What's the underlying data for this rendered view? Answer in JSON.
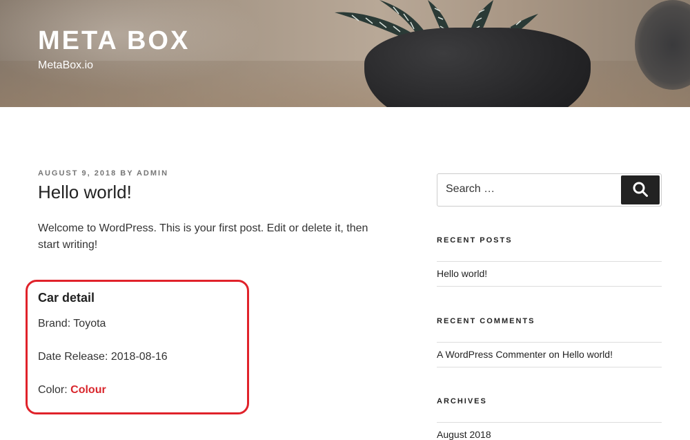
{
  "site": {
    "title": "META BOX",
    "description": "MetaBox.io"
  },
  "post": {
    "meta": "AUGUST 9, 2018 BY ADMIN",
    "title": "Hello world!",
    "body": "Welcome to WordPress. This is your first post. Edit or delete it, then start writing!"
  },
  "car_detail": {
    "heading": "Car detail",
    "brand_label": "Brand:",
    "brand_value": "Toyota",
    "date_label": "Date Release:",
    "date_value": "2018-08-16",
    "color_label": "Color:",
    "color_value": "Colour",
    "highlight_color": "#e0222a"
  },
  "sidebar": {
    "search": {
      "placeholder": "Search …",
      "button_icon": "search-icon"
    },
    "recent_posts": {
      "title": "RECENT POSTS",
      "items": [
        "Hello world!"
      ]
    },
    "recent_comments": {
      "title": "RECENT COMMENTS",
      "items": [
        {
          "author": "A WordPress Commenter",
          "connector": "on",
          "post": "Hello world!"
        }
      ]
    },
    "archives": {
      "title": "ARCHIVES",
      "items": [
        "August 2018"
      ]
    }
  }
}
